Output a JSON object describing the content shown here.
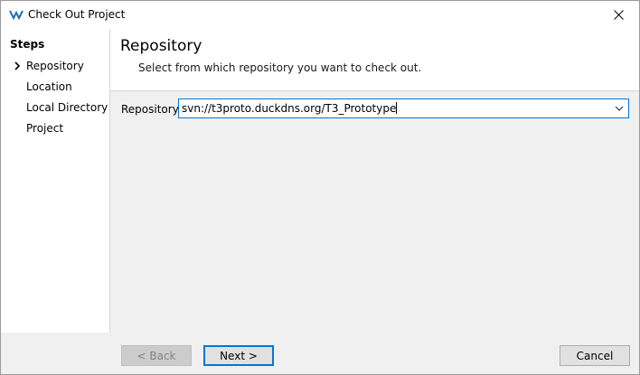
{
  "window": {
    "title": "Check Out Project"
  },
  "sidebar": {
    "title": "Steps",
    "items": [
      {
        "label": "Repository",
        "current": true
      },
      {
        "label": "Location"
      },
      {
        "label": "Local Directory"
      },
      {
        "label": "Project"
      }
    ]
  },
  "header": {
    "title": "Repository",
    "description": "Select from which repository you want to check out."
  },
  "form": {
    "repository_label": "Repository:",
    "repository_value": "svn://t3proto.duckdns.org/T3_Prototype"
  },
  "footer": {
    "back_label": "< Back",
    "next_label": "Next >",
    "cancel_label": "Cancel"
  },
  "colors": {
    "accent": "#0078d7",
    "app_icon": "#1e6fb8"
  },
  "icons": {
    "app": "app-logo-icon",
    "close": "close-icon",
    "current_step": "chevron-right-icon",
    "dropdown": "chevron-down-icon"
  }
}
